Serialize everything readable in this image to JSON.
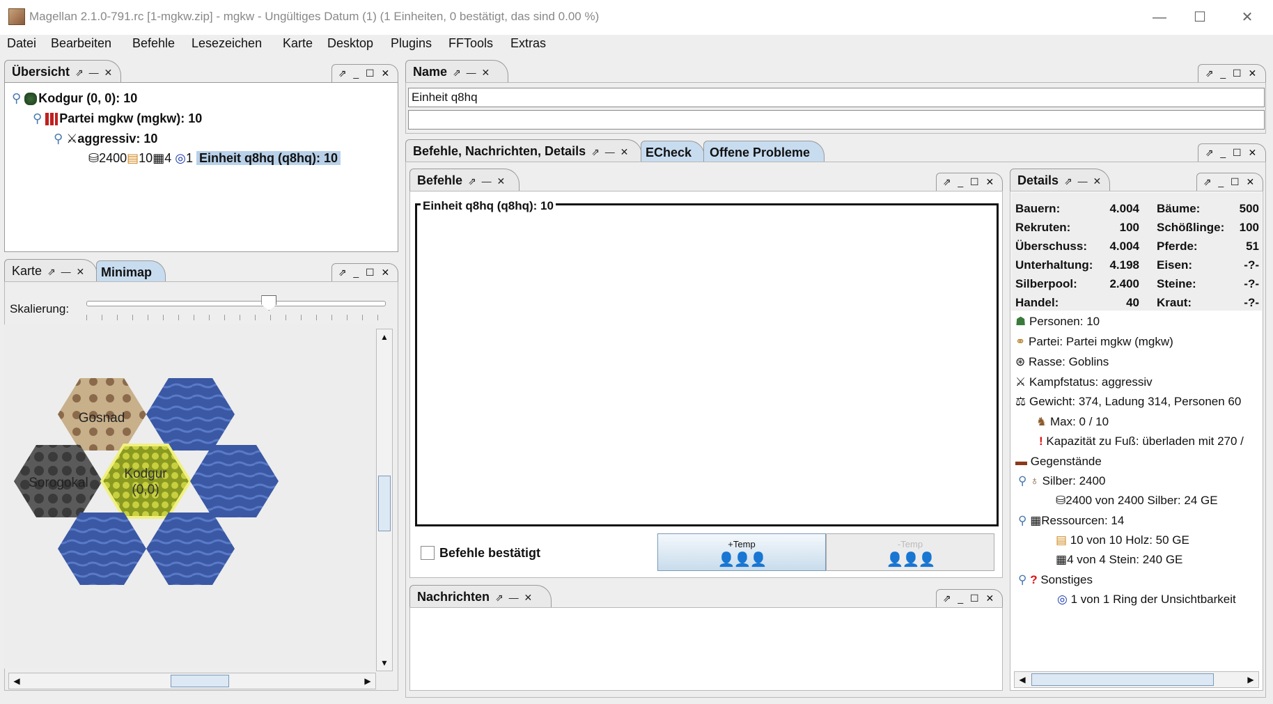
{
  "window": {
    "title": "Magellan 2.1.0-791.rc [1-mgkw.zip] - mgkw - Ungültiges Datum (1) (1 Einheiten, 0 bestätigt, das sind 0.00 %)",
    "min": "—",
    "max": "☐",
    "close": "✕"
  },
  "menu": [
    "Datei",
    "Bearbeiten",
    "Befehle",
    "Lesezeichen",
    "Karte",
    "Desktop",
    "Plugins",
    "FFTools",
    "Extras"
  ],
  "overview": {
    "tab": "Übersicht",
    "region": "Kodgur (0, 0): 10",
    "faction": "Partei mgkw (mgkw): 10",
    "combat": "aggressiv: 10",
    "unit_silver": "2400",
    "unit_wood": "10",
    "unit_stone": "4",
    "unit_ring": "1",
    "unit_label": "Einheit q8hq (q8hq): 10"
  },
  "map": {
    "tab_karte": "Karte",
    "tab_minimap": "Minimap",
    "scale_label": "Skalierung:",
    "slider_level": 0.61,
    "hex_gosnad": "Gosnad",
    "hex_kodgur": "Kodgur",
    "hex_kodgur_coords": "(0,0)",
    "hex_sorogokal": "Sorogokal"
  },
  "name_panel": {
    "tab": "Name",
    "name_value": "Einheit q8hq",
    "desc_value": ""
  },
  "orders_tabs": {
    "tab_main": "Befehle, Nachrichten, Details",
    "tab_echeck": "ECheck",
    "tab_problems": "Offene Probleme"
  },
  "orders": {
    "tab": "Befehle",
    "group_title": "Einheit q8hq (q8hq): 10",
    "confirmed_label": "Befehle bestätigt",
    "temp_label": "+Temp",
    "del_label": "-Temp"
  },
  "messages": {
    "tab": "Nachrichten"
  },
  "details": {
    "tab": "Details",
    "stats_left": [
      {
        "k": "Bauern:",
        "v": "4.004"
      },
      {
        "k": "Rekruten:",
        "v": "100"
      },
      {
        "k": "Überschuss:",
        "v": "4.004"
      },
      {
        "k": "Unterhaltung:",
        "v": "4.198"
      },
      {
        "k": "Silberpool:",
        "v": "2.400"
      },
      {
        "k": "Handel:",
        "v": "40"
      }
    ],
    "stats_right": [
      {
        "k": "Bäume:",
        "v": "500"
      },
      {
        "k": "Schößlinge:",
        "v": "100"
      },
      {
        "k": "Pferde:",
        "v": "51"
      },
      {
        "k": "Eisen:",
        "v": "-?-"
      },
      {
        "k": "Steine:",
        "v": "-?-"
      },
      {
        "k": "Kraut:",
        "v": "-?-"
      }
    ],
    "persons": "Personen: 10",
    "party": "Partei: Partei mgkw (mgkw)",
    "race": "Rasse: Goblins",
    "combat": "Kampfstatus: aggressiv",
    "weight": "Gewicht: 374, Ladung 314, Personen 60",
    "max": "Max: 0 / 10",
    "capacity": "Kapazität zu Fuß: überladen mit 270 /",
    "items": "Gegenstände",
    "silver": "Silber: 2400",
    "silver_detail": "2400 von 2400 Silber: 24 GE",
    "resources": "Ressourcen: 14",
    "wood_detail": "10 von 10 Holz: 50 GE",
    "stone_detail": "4 von 4 Stein: 240 GE",
    "misc": "Sonstiges",
    "ring_detail": "1 von 1 Ring der Unsichtbarkeit"
  },
  "colors": {
    "selection": "#b8d0e8",
    "ocean": "#3f5fa8",
    "swamp": "#c8d040",
    "mountain": "#555555"
  }
}
